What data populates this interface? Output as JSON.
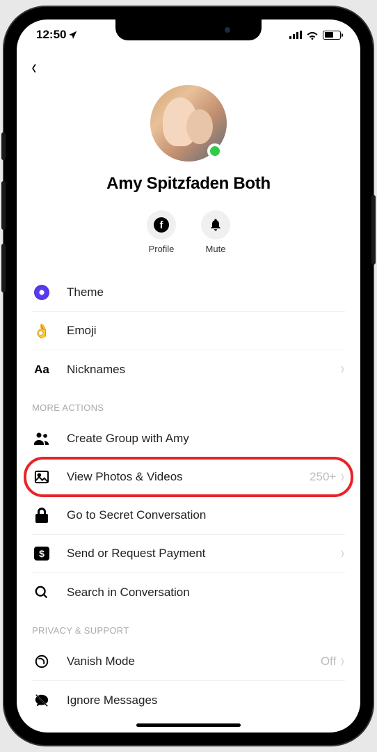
{
  "status": {
    "time": "12:50"
  },
  "profile": {
    "name": "Amy Spitzfaden Both"
  },
  "actions": {
    "profile_label": "Profile",
    "mute_label": "Mute"
  },
  "settings": {
    "theme": "Theme",
    "emoji": "Emoji",
    "nicknames": "Nicknames"
  },
  "sections": {
    "more_actions": "More Actions",
    "privacy_support": "Privacy & Support"
  },
  "more": {
    "create_group": "Create Group with Amy",
    "view_photos": "View Photos & Videos",
    "view_photos_count": "250+",
    "secret_conversation": "Go to Secret Conversation",
    "send_payment": "Send or Request Payment",
    "search": "Search in Conversation"
  },
  "privacy": {
    "vanish_mode": "Vanish Mode",
    "vanish_value": "Off",
    "ignore": "Ignore Messages"
  }
}
